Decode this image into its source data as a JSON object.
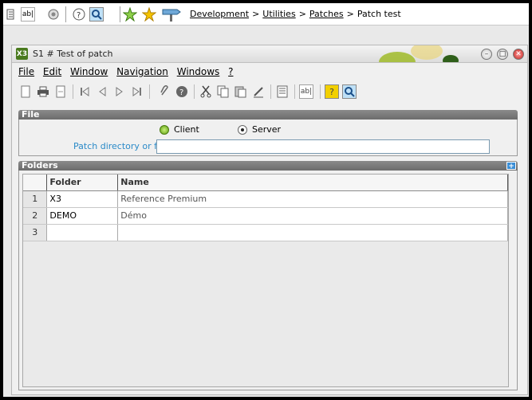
{
  "topbar": {
    "icons": [
      "list-icon",
      "text-field-icon",
      "settings-icon",
      "help-icon",
      "search-icon",
      "star-add-icon",
      "star-icon",
      "signpost-icon"
    ],
    "breadcrumb": {
      "items": [
        "Development",
        "Utilities",
        "Patches"
      ],
      "current": "Patch test",
      "separator": ">"
    }
  },
  "window": {
    "title": "S1 # Test of patch",
    "title_icon": "X3",
    "controls": {
      "minimize": "–",
      "restore": "□",
      "close": "✕"
    }
  },
  "menu": {
    "items": [
      "File",
      "Edit",
      "Window",
      "Navigation",
      "Windows",
      "?"
    ]
  },
  "toolbar": {
    "icons": [
      "new-icon",
      "print-icon",
      "export-icon",
      "first-icon",
      "previous-icon",
      "next-icon",
      "last-icon",
      "attach-icon",
      "info-icon",
      "cut-icon",
      "copy-icon",
      "paste-icon",
      "edit-icon",
      "list-icon",
      "text-field-icon",
      "help-icon",
      "search-icon"
    ],
    "text_field_label": "ab|",
    "help_label": "?"
  },
  "file_section": {
    "header": "File",
    "radio_client": "Client",
    "radio_server": "Server",
    "selected": "Server",
    "patch_label": "Patch directory or file",
    "patch_value": ""
  },
  "folders_section": {
    "header": "Folders",
    "columns": [
      "Folder",
      "Name"
    ],
    "rows": [
      {
        "num": "1",
        "folder": "X3",
        "name": "Reference Premium"
      },
      {
        "num": "2",
        "folder": "DEMO",
        "name": "Démo"
      },
      {
        "num": "3",
        "folder": "",
        "name": ""
      }
    ]
  },
  "colors": {
    "section_header": "#7a7a7a",
    "label_blue": "#2a8ac8",
    "accent_green": "#5fa012"
  }
}
